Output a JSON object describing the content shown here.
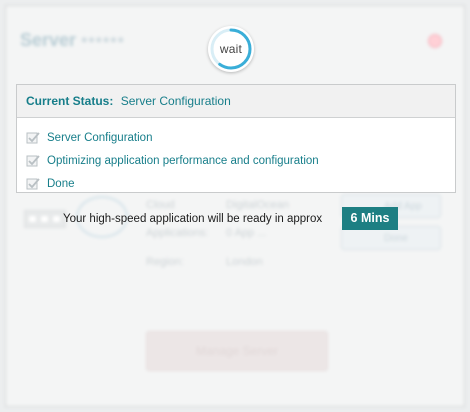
{
  "background": {
    "server_title": "Server",
    "server_id": "••••••",
    "labels": [
      "Cloud",
      "Applications:",
      "Region:"
    ],
    "values": [
      "DigitalOcean",
      "0 App ...",
      "London"
    ],
    "button_label": "Manage Server",
    "side_buttons": [
      "Add App",
      "Done"
    ]
  },
  "wait": {
    "label": "wait",
    "progress": 0.6
  },
  "status": {
    "title_key": "Current Status:",
    "title_value": "Server Configuration",
    "steps": [
      {
        "label": "Server Configuration",
        "done": true
      },
      {
        "label": "Optimizing application performance and configuration",
        "done": true
      },
      {
        "label": "Done",
        "done": true
      }
    ]
  },
  "ready": {
    "message": "Your high-speed application will be ready in approx",
    "eta": "6 Mins"
  },
  "colors": {
    "accent": "#177e8a",
    "eta_bg": "#1d7f83",
    "spinner": "#3aaed8",
    "check": "#b9c0c4"
  }
}
